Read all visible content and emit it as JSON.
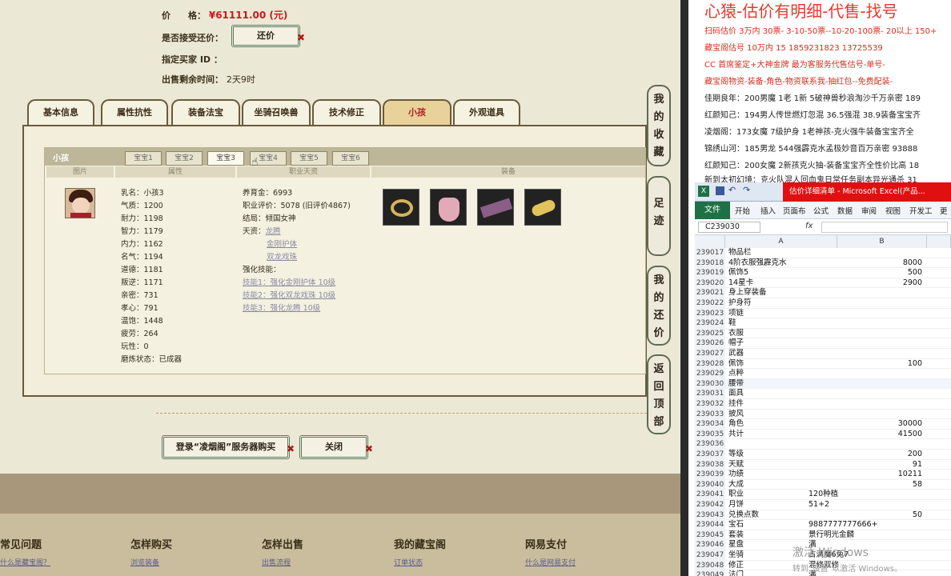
{
  "listing": {
    "price_label": "价　　格：",
    "price_value": "¥61111.00 (元)",
    "accept_offer_label": "是否接受还价：",
    "offer_button": "还价",
    "buyer_label": "指定买家 ID ：",
    "remaining_label": "出售剩余时间：",
    "remaining_value": "2天9时"
  },
  "main_tabs": [
    "基本信息",
    "属性抗性",
    "装备法宝",
    "坐骑召唤兽",
    "技术修正",
    "小孩",
    "外观道具"
  ],
  "active_main_tab": "小孩",
  "panel_title": "小孩",
  "sub_tabs": [
    "宝宝1",
    "宝宝2",
    "宝宝3",
    "宝宝4",
    "宝宝5",
    "宝宝6"
  ],
  "active_sub_tab": "宝宝3",
  "column_headers": [
    "图片",
    "属性",
    "职业天资",
    "装备"
  ],
  "attributes": [
    "乳名：小孩3",
    "气质：1200",
    "耐力：1198",
    "智力：1179",
    "内力：1162",
    "名气：1194",
    "道德：1181",
    "叛逆：1171",
    "亲密：731",
    "孝心：791",
    "温饱：1448",
    "疲劳：264",
    "玩性：0",
    "磨炼状态：已成器"
  ],
  "career": {
    "fund": "养育金：6993",
    "rating": "职业评价：5078 (旧评价4867)",
    "ending": "结局：倾国女神",
    "talent_label": "天资：",
    "talents": [
      "龙腾",
      "金刚护体",
      "双龙戏珠"
    ],
    "skill_label": "强化技能：",
    "skills": [
      "技能1：强化金刚护体 10级",
      "技能2：强化双龙戏珠 10级",
      "技能3：强化龙腾 10级"
    ]
  },
  "equipment_icons": [
    "ring-equipment-icon",
    "pouch-equipment-icon",
    "scroll-equipment-icon",
    "shoes-equipment-icon"
  ],
  "bottom_buttons": {
    "buy": "登录“凌烟阁”服务器购买",
    "close": "关闭"
  },
  "side_buttons": [
    "我的收藏",
    "足迹",
    "我的还价",
    "返回顶部"
  ],
  "footer": {
    "columns": [
      "常见问题",
      "怎样购买",
      "怎样出售",
      "我的藏宝阁",
      "网易支付"
    ],
    "links": [
      "什么是藏宝阁？",
      "浏览装备",
      "出售流程",
      "订单状态",
      "什么是网易支付"
    ]
  },
  "right_panel": {
    "headline": "心猿-估价有明细-代售-找号",
    "lines": [
      "扫码估价 3万内 30票- 3-10-50票--10-20-100票- 20以上 150+",
      "藏宝阁估号 10万内  15 1859231823  13725539",
      "CC 首席鉴定+大神金牌 最为客服务代售估号-单号-",
      "藏宝阁物资-装备-角色-物资联系我-抽红包--免费配装-",
      "佳期良年：200男魔 1老 1新 5破神兽秒浪淘沙千万亲密 189",
      "红颜知己：194男人传世燃灯忽混 36.5强混 38.9装备宝宝齐",
      "凌烟阁：173女魔 7级护身 1老神孩-克火强牛装备宝宝齐全",
      "锦绣山河：185男龙 544强霹克水孟极妙音百万亲密 93888",
      "红颜知己：200女魔 2新孩克火抽-装备宝宝齐全性价比高 18",
      "新到太初幻境：克火队混人回血鬼日常任务副本异光通杀 31"
    ],
    "excel_title": "估价详细清单 - Microsoft Excel(产品...",
    "ribbon_tabs": [
      "文件",
      "开始",
      "插入",
      "页面布",
      "公式",
      "数据",
      "审阅",
      "视图",
      "开发工",
      "更"
    ],
    "name_box": "C239030",
    "fx": "fx",
    "col_a": "A",
    "col_b": "B",
    "rows": [
      [
        "239017",
        "物品栏",
        ""
      ],
      [
        "239018",
        "4阶衣服强霹克水",
        "8000"
      ],
      [
        "239019",
        "佩饰5",
        "500"
      ],
      [
        "239020",
        "14星卡",
        "2900"
      ],
      [
        "239021",
        "身上穿装备",
        ""
      ],
      [
        "239022",
        "护身符",
        ""
      ],
      [
        "239023",
        "项链",
        ""
      ],
      [
        "239024",
        "鞋",
        ""
      ],
      [
        "239025",
        "衣服",
        ""
      ],
      [
        "239026",
        "帽子",
        ""
      ],
      [
        "239027",
        "武器",
        ""
      ],
      [
        "239028",
        "佩饰",
        "100"
      ],
      [
        "239029",
        "点粹",
        ""
      ],
      [
        "239030",
        "腰带",
        ""
      ],
      [
        "239031",
        "面具",
        ""
      ],
      [
        "239032",
        "挂件",
        ""
      ],
      [
        "239033",
        "披风",
        ""
      ],
      [
        "239034",
        "角色",
        "30000"
      ],
      [
        "239035",
        "共计",
        "41500"
      ],
      [
        "239036",
        "",
        ""
      ],
      [
        "239037",
        "等级",
        "200"
      ],
      [
        "239038",
        "天赋",
        "91"
      ],
      [
        "239039",
        "功绩",
        "10211"
      ],
      [
        "239040",
        "大成",
        "58"
      ],
      [
        "239041",
        "职业",
        "120种植"
      ],
      [
        "239042",
        "月饼",
        "51+2"
      ],
      [
        "239043",
        "兑换点数",
        "50"
      ],
      [
        "239044",
        "宝石",
        "9887777777666+"
      ],
      [
        "239045",
        "套装",
        "景行明光金麟"
      ],
      [
        "239046",
        "星盘",
        "满"
      ],
      [
        "239047",
        "坐骑",
        "占满魔6兔7"
      ],
      [
        "239048",
        "修正",
        "混修双修"
      ],
      [
        "239049",
        "法门",
        "满"
      ]
    ],
    "watermark_1": "激活 Windows",
    "watermark_2": "转到\"设置\"以激活 Windows。"
  }
}
